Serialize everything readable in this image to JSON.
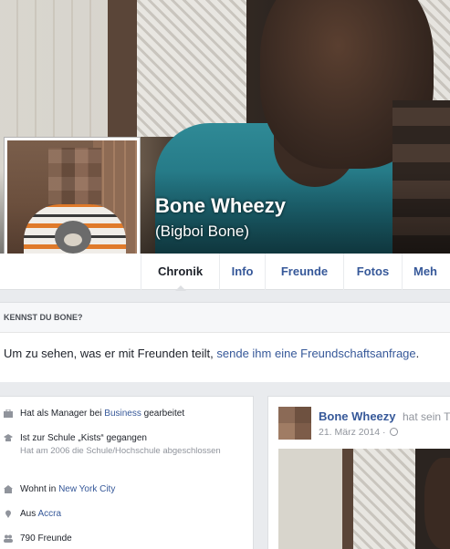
{
  "profile": {
    "name": "Bone Wheezy",
    "alternate_name": "(Bigboi Bone)"
  },
  "tabs": [
    {
      "label": "Chronik",
      "active": true
    },
    {
      "label": "Info"
    },
    {
      "label": "Freunde"
    },
    {
      "label": "Fotos"
    },
    {
      "label": "Meh"
    }
  ],
  "know": {
    "heading": "KENNST DU BONE?",
    "text": "Um zu sehen, was er mit Freunden teilt,",
    "link": "sende ihm eine Freundschaftsanfrage",
    "suffix": "."
  },
  "intro": {
    "work_prefix": "Hat als Manager bei",
    "work_link": "Business",
    "work_suffix": "gearbeitet",
    "school_text": "Ist zur Schule „Kists“ gegangen",
    "school_sub": "Hat am 2006 die Schule/Hochschule abgeschlossen",
    "lives_prefix": "Wohnt in",
    "lives_link": "New York City",
    "from_prefix": "Aus",
    "from_link": "Accra",
    "friends": "790 Freunde"
  },
  "post": {
    "author": "Bone Wheezy",
    "action": "hat sein T",
    "date": "21. März 2014 ·"
  },
  "icons": {
    "work": "briefcase-icon",
    "school": "graduation-cap-icon",
    "home": "house-icon",
    "location": "location-pin-icon",
    "friends": "friends-icon",
    "privacy": "globe-icon"
  },
  "colors": {
    "link": "#365899",
    "background": "#e9ebee",
    "muted": "#90949c"
  }
}
